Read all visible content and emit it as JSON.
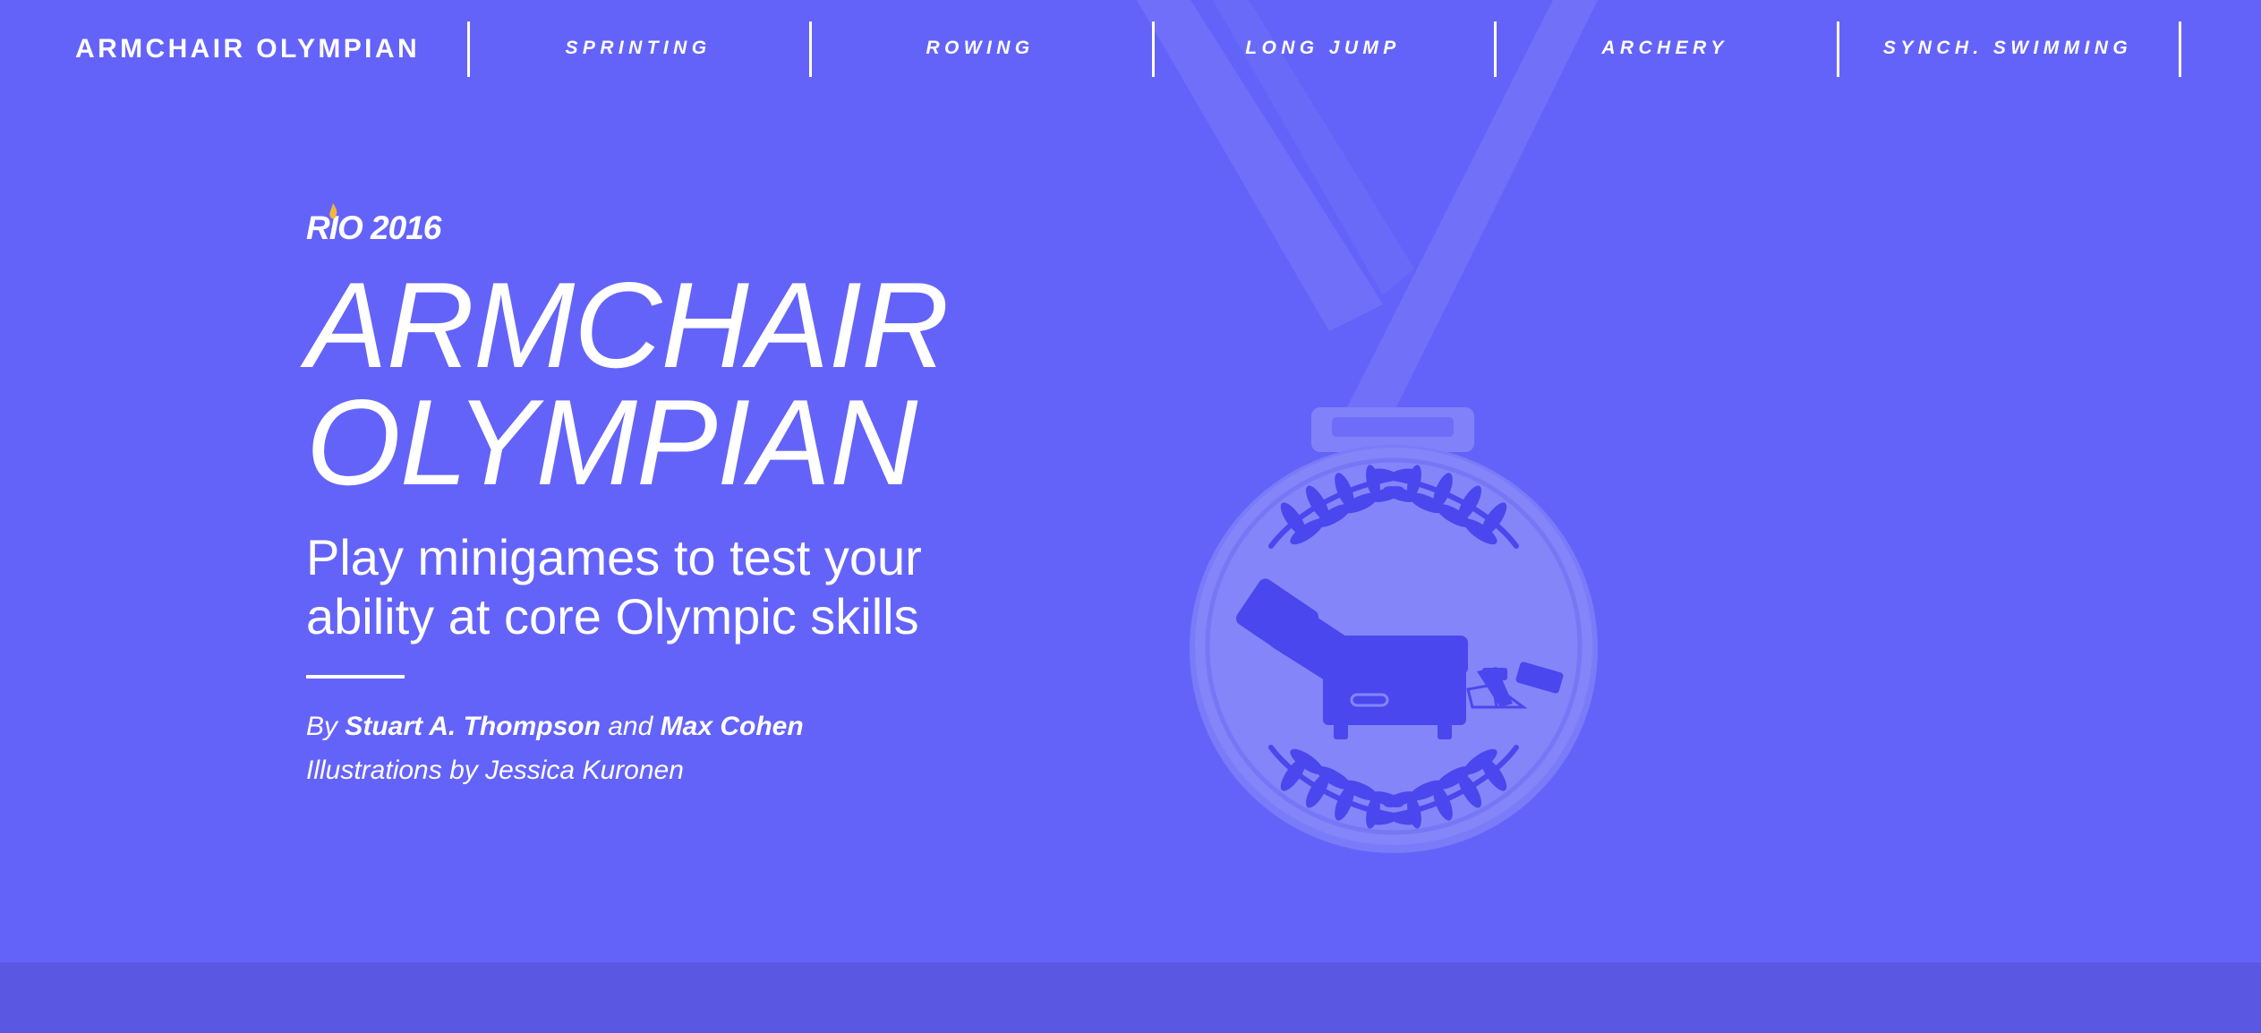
{
  "nav": {
    "brand": "ARMCHAIR OLYMPIAN",
    "items": [
      {
        "label": "SPRINTING"
      },
      {
        "label": "ROWING"
      },
      {
        "label": "LONG JUMP"
      },
      {
        "label": "ARCHERY"
      },
      {
        "label": "SYNCH. SWIMMING"
      }
    ]
  },
  "hero": {
    "event_logo": "RIO 2016",
    "title_line1": "ARMCHAIR",
    "title_line2": "OLYMPIAN",
    "subtitle_line1": "Play minigames to test your",
    "subtitle_line2": "ability at core Olympic skills",
    "byline": {
      "prefix": "By ",
      "author1": "Stuart A. Thompson",
      "conjunction": " and ",
      "author2": "Max Cohen"
    },
    "illustrations": "Illustrations by Jessica Kuronen"
  },
  "icons": {
    "medal": "armchair-medal-illustration",
    "flame": "olympic-flame-icon"
  },
  "colors": {
    "background": "#6463f9",
    "bottom_band": "#5a58e3",
    "medal_face": "#8182f9",
    "medal_emblem": "#4a47ee",
    "flame": "#f4b63a",
    "text": "#ffffff"
  }
}
